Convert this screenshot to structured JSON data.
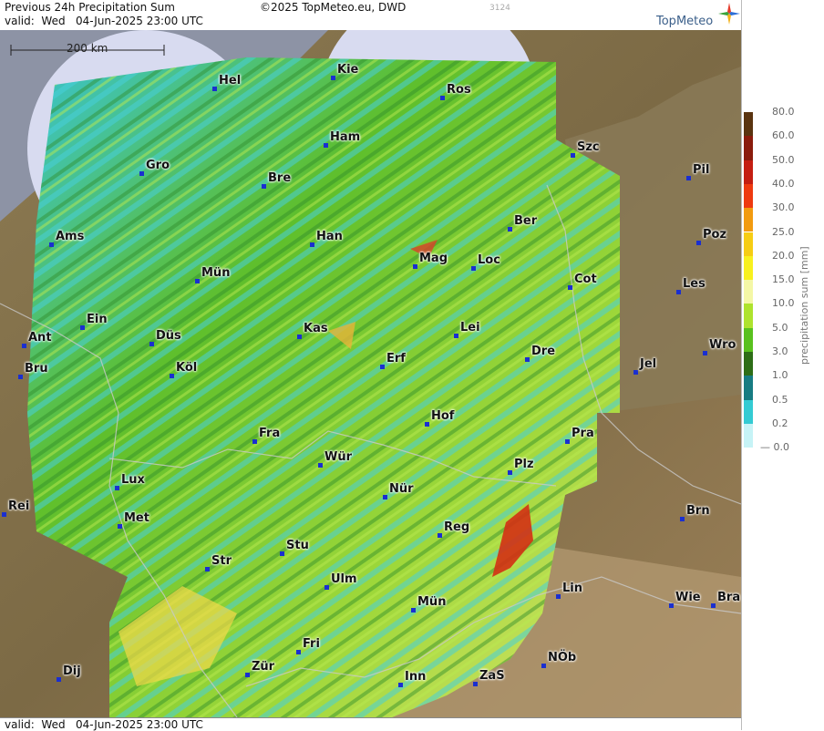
{
  "header": {
    "title": "Previous 24h Precipitation Sum",
    "valid": "valid:  Wed   04-Jun-2025 23:00 UTC",
    "copyright": "©2025 TopMeteo.eu, DWD",
    "code": "3124",
    "logo": "TopMeteo"
  },
  "footer": {
    "valid": "valid:  Wed   04-Jun-2025 23:00 UTC"
  },
  "scale_bar": {
    "label": "200 km"
  },
  "legend": {
    "title": "precipitation sum [mm]",
    "levels": [
      {
        "label": "80.0",
        "color": "#5a3410"
      },
      {
        "label": "60.0",
        "color": "#8a1c0c"
      },
      {
        "label": "50.0",
        "color": "#c41e12"
      },
      {
        "label": "40.0",
        "color": "#ee3a10"
      },
      {
        "label": "30.0",
        "color": "#f29b10"
      },
      {
        "label": "25.0",
        "color": "#f6cd14"
      },
      {
        "label": "20.0",
        "color": "#f8f11e"
      },
      {
        "label": "15.0",
        "color": "#f4f7a6"
      },
      {
        "label": "10.0",
        "color": "#aee32e"
      },
      {
        "label": "5.0",
        "color": "#59c11f"
      },
      {
        "label": "3.0",
        "color": "#2e6e17"
      },
      {
        "label": "1.0",
        "color": "#177c82"
      },
      {
        "label": "0.5",
        "color": "#34cbd3"
      },
      {
        "label": "0.2",
        "color": "#c6f3f6"
      },
      {
        "label": "0.0",
        "color": "#ffffff"
      }
    ]
  },
  "cities": [
    {
      "name": "Hel"
    },
    {
      "name": "Kie"
    },
    {
      "name": "Ros"
    },
    {
      "name": "Ham"
    },
    {
      "name": "Gro"
    },
    {
      "name": "Bre"
    },
    {
      "name": "Szc"
    },
    {
      "name": "Pil"
    },
    {
      "name": "Ber"
    },
    {
      "name": "Ams"
    },
    {
      "name": "Han"
    },
    {
      "name": "Poz"
    },
    {
      "name": "Mag"
    },
    {
      "name": "Loc"
    },
    {
      "name": "Mün"
    },
    {
      "name": "Cot"
    },
    {
      "name": "Les"
    },
    {
      "name": "Ein"
    },
    {
      "name": "Kas"
    },
    {
      "name": "Lei"
    },
    {
      "name": "Ant"
    },
    {
      "name": "Düs"
    },
    {
      "name": "Wro"
    },
    {
      "name": "Dre"
    },
    {
      "name": "Erf"
    },
    {
      "name": "Bru"
    },
    {
      "name": "Köl"
    },
    {
      "name": "Jel"
    },
    {
      "name": "Hof"
    },
    {
      "name": "Fra"
    },
    {
      "name": "Pra"
    },
    {
      "name": "Wür"
    },
    {
      "name": "Plz"
    },
    {
      "name": "Lux"
    },
    {
      "name": "Nür"
    },
    {
      "name": "Rei"
    },
    {
      "name": "Met"
    },
    {
      "name": "Brn"
    },
    {
      "name": "Reg"
    },
    {
      "name": "Stu"
    },
    {
      "name": "Str"
    },
    {
      "name": "Ulm"
    },
    {
      "name": "Lin"
    },
    {
      "name": "Wie"
    },
    {
      "name": "Bra"
    },
    {
      "name": "Mün"
    },
    {
      "name": "Fri"
    },
    {
      "name": "NÖb"
    },
    {
      "name": "Zür"
    },
    {
      "name": "Dij"
    },
    {
      "name": "Inn"
    },
    {
      "name": "ZaS"
    }
  ]
}
